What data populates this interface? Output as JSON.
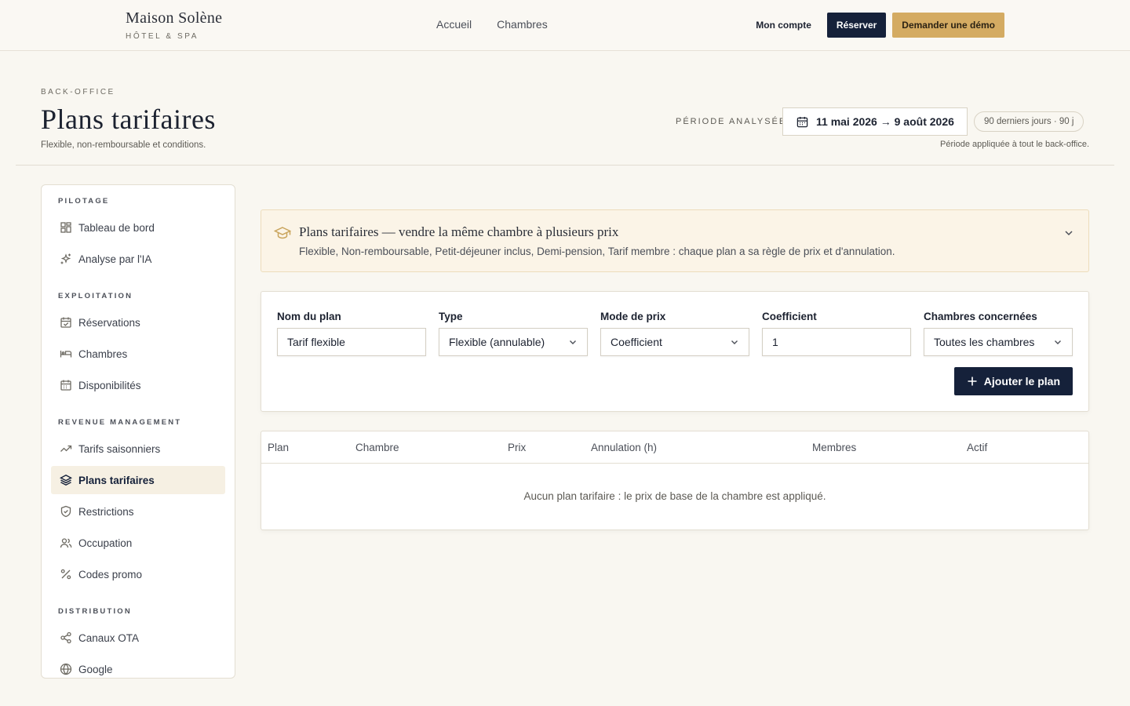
{
  "brand": {
    "name": "Maison Solène",
    "sub": "HÔTEL & SPA"
  },
  "nav": {
    "links": [
      "Accueil",
      "Chambres"
    ],
    "account": "Mon compte",
    "reserve": "Réserver",
    "demo": "Demander une démo"
  },
  "header": {
    "eyebrow": "BACK-OFFICE",
    "title": "Plans tarifaires",
    "subtitle": "Flexible, non-remboursable et conditions.",
    "period_label": "PÉRIODE ANALYSÉE",
    "period_range": "11 mai 2026 → 9 août 2026",
    "period_chip": "90 derniers jours · 90 j",
    "period_note": "Période appliquée à tout le back-office."
  },
  "sidebar": {
    "sections": [
      {
        "title": "PILOTAGE",
        "items": [
          {
            "label": "Tableau de bord",
            "icon": "dashboard-icon"
          },
          {
            "label": "Analyse par l'IA",
            "icon": "sparkles-icon"
          }
        ]
      },
      {
        "title": "EXPLOITATION",
        "items": [
          {
            "label": "Réservations",
            "icon": "calendar-check-icon"
          },
          {
            "label": "Chambres",
            "icon": "bed-icon"
          },
          {
            "label": "Disponibilités",
            "icon": "calendar-grid-icon"
          }
        ]
      },
      {
        "title": "REVENUE MANAGEMENT",
        "items": [
          {
            "label": "Tarifs saisonniers",
            "icon": "trend-up-icon"
          },
          {
            "label": "Plans tarifaires",
            "icon": "layers-icon"
          },
          {
            "label": "Restrictions",
            "icon": "shield-check-icon"
          },
          {
            "label": "Occupation",
            "icon": "users-icon"
          },
          {
            "label": "Codes promo",
            "icon": "percent-icon"
          }
        ]
      },
      {
        "title": "DISTRIBUTION",
        "items": [
          {
            "label": "Canaux OTA",
            "icon": "share-icon"
          },
          {
            "label": "Google",
            "icon": "globe-icon"
          }
        ]
      }
    ]
  },
  "banner": {
    "title": "Plans tarifaires — vendre la même chambre à plusieurs prix",
    "text": "Flexible, Non-remboursable, Petit-déjeuner inclus, Demi-pension, Tarif membre : chaque plan a sa règle de prix et d'annulation."
  },
  "form": {
    "name_label": "Nom du plan",
    "name_value": "Tarif flexible",
    "type_label": "Type",
    "type_value": "Flexible (annulable)",
    "mode_label": "Mode de prix",
    "mode_value": "Coefficient",
    "coef_label": "Coefficient",
    "coef_value": "1",
    "rooms_label": "Chambres concernées",
    "rooms_value": "Toutes les chambres",
    "add_label": "Ajouter le plan"
  },
  "table": {
    "columns": [
      "Plan",
      "Chambre",
      "Prix",
      "Annulation (h)",
      "Membres",
      "Actif"
    ],
    "empty": "Aucun plan tarifaire : le prix de base de la chambre est appliqué."
  },
  "colors": {
    "navy": "#15213a",
    "gold": "#d4ab62",
    "background": "#f9f7f1",
    "active_bg": "#f6f0e3"
  }
}
